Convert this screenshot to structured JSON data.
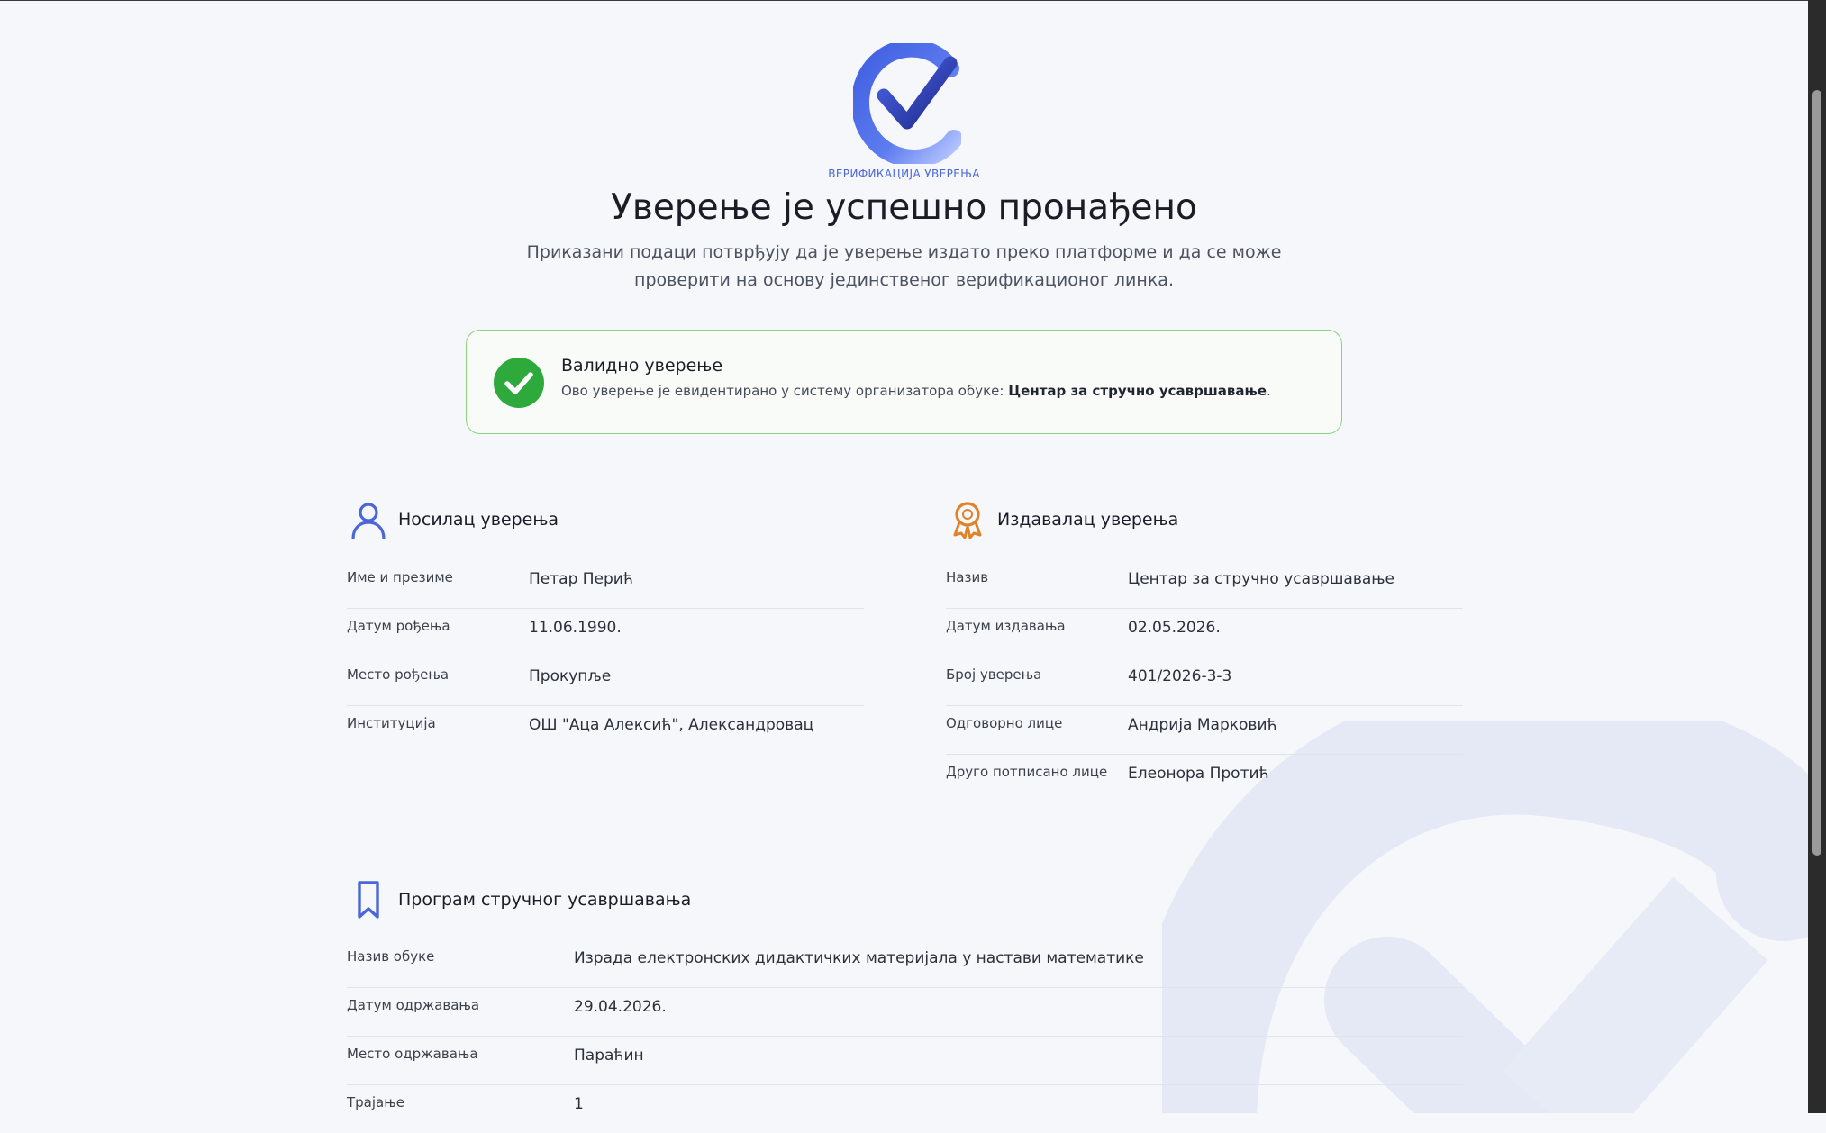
{
  "header": {
    "logo_caption": "ВЕРИФИКАЦИЈА УВЕРЕЊА",
    "title": "Уверење је успешно пронађено",
    "subtitle": "Приказани подаци потврђују да је уверење издато преко платформе и да се може проверити на основу јединственог верификационог линка."
  },
  "status": {
    "title": "Валидно уверење",
    "text_prefix": "Ово уверење је евидентирано у систему организатора обуке: ",
    "organizer": "Центар за стручно усавршавање",
    "text_suffix": "."
  },
  "holder": {
    "title": "Носилац уверења",
    "rows": [
      {
        "label": "Име и презиме",
        "value": "Петар Перић"
      },
      {
        "label": "Датум рођења",
        "value": "11.06.1990."
      },
      {
        "label": "Место рођења",
        "value": "Прокупље"
      },
      {
        "label": "Институција",
        "value": "ОШ \"Аца Алексић\", Александровац"
      }
    ]
  },
  "issuer": {
    "title": "Издавалац уверења",
    "rows": [
      {
        "label": "Назив",
        "value": "Центар за стручно усавршавање"
      },
      {
        "label": "Датум издавања",
        "value": "02.05.2026."
      },
      {
        "label": "Број уверења",
        "value": "401/2026-3-3"
      },
      {
        "label": "Одговорно лице",
        "value": "Андрија Марковић"
      },
      {
        "label": "Друго потписано лице",
        "value": "Елеонора Протић"
      }
    ]
  },
  "program": {
    "title": "Програм стручног усавршавања",
    "rows": [
      {
        "label": "Назив обуке",
        "value": "Израда електронских дидактичких материјала у настави математике"
      },
      {
        "label": "Датум одржавања",
        "value": "29.04.2026."
      },
      {
        "label": "Место одржавања",
        "value": "Параћин"
      },
      {
        "label": "Трајање",
        "value": "1"
      }
    ]
  },
  "colors": {
    "accent_blue": "#4b66d8",
    "valid_green": "#2eaa3c",
    "issuer_orange": "#e0822a",
    "border_green": "#8ed27e"
  },
  "icons": {
    "logo": "check-logo-icon",
    "status": "check-circle-icon",
    "holder": "user-icon",
    "issuer": "award-icon",
    "program": "bookmark-icon"
  }
}
